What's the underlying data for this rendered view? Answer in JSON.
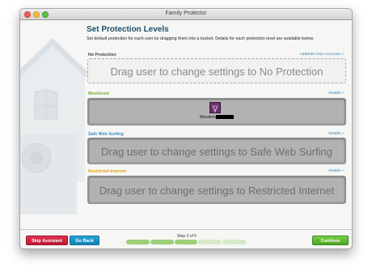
{
  "window": {
    "title": "Family Protector"
  },
  "header": {
    "title": "Set Protection Levels",
    "description": "Set default protection for each user by dragging them into a bucket. Details for each protection level are available below."
  },
  "buckets": [
    {
      "label": "No Protection",
      "link": "Add/Edit User Accounts »",
      "drop_text": "Drag user to change settings to No Protection",
      "color": "#444444"
    },
    {
      "label": "Monitored",
      "link": "Details »",
      "user": {
        "name": "Massimo",
        "icon": "user-avatar-icon"
      },
      "color": "#6fb230"
    },
    {
      "label": "Safe Web Surfing",
      "link": "Details »",
      "drop_text": "Drag user to change settings to Safe Web Surfing",
      "color": "#3a8ec9"
    },
    {
      "label": "Restricted Internet",
      "link": "Details »",
      "drop_text": "Drag user to change settings to Restricted Internet",
      "color": "#e0a21a"
    }
  ],
  "footer": {
    "skip_label": "Skip Assistant",
    "back_label": "Go Back",
    "continue_label": "Continue",
    "step_text": "Step 3 of 5",
    "step_current": 3,
    "step_total": 5
  },
  "colors": {
    "accent_title": "#1e4f6d",
    "skip": "#cf2540",
    "back": "#1d8fc4",
    "continue": "#5fba32"
  }
}
